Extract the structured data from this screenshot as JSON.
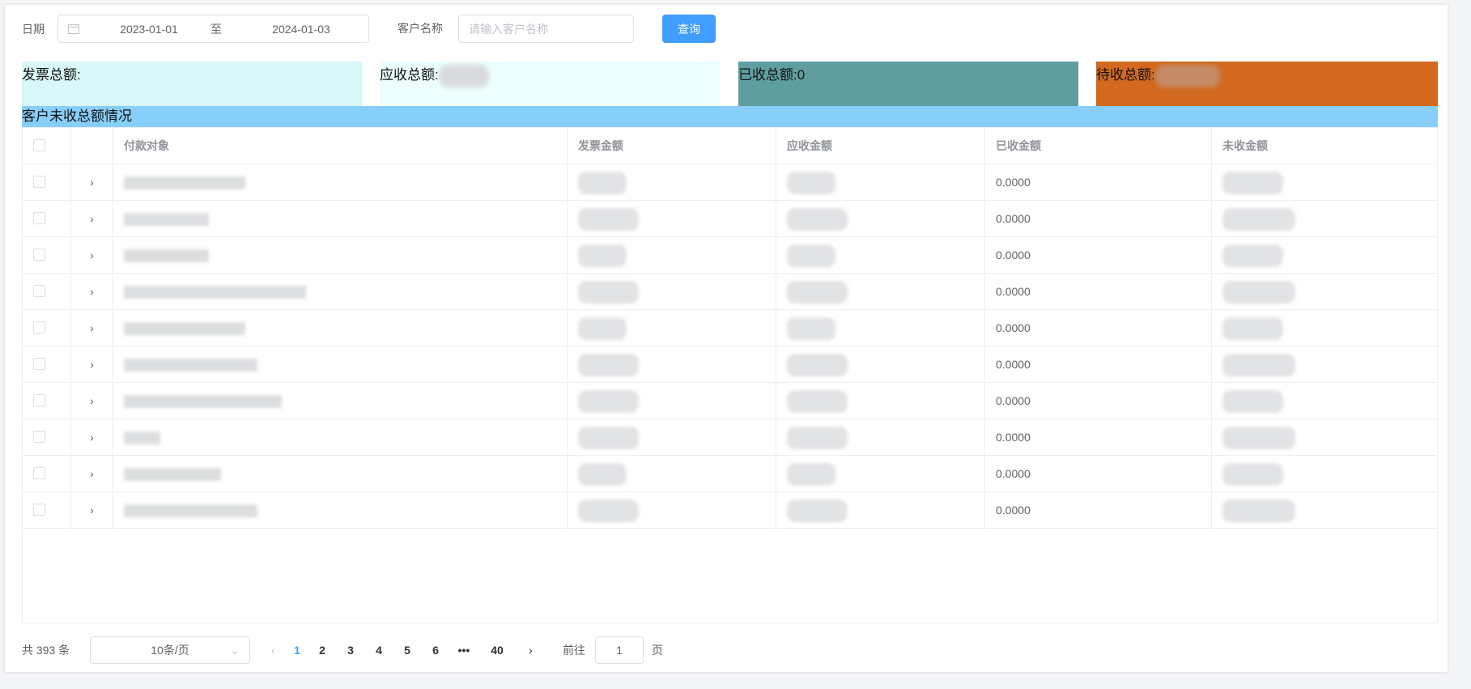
{
  "filter": {
    "date_label": "日期",
    "date_start": "2023-01-01",
    "date_separator": "至",
    "date_end": "2024-01-03",
    "customer_label": "客户名称",
    "customer_placeholder": "请输入客户名称",
    "query_button": "查询"
  },
  "summary": {
    "invoice_total_label": "发票总额:",
    "receivable_total_label": "应收总额:",
    "received_total_label": "已收总额:0",
    "pending_total_label": "待收总额:",
    "colors": {
      "invoice": "#d9f6f8",
      "receivable": "#ecfefe",
      "received": "#5f9ea0",
      "pending": "#d2691e"
    }
  },
  "section_title": "客户未收总额情况",
  "table": {
    "columns": [
      "付款对象",
      "发票金额",
      "应收金额",
      "已收金额",
      "未收金额"
    ],
    "rows": [
      {
        "received": "0.0000"
      },
      {
        "received": "0.0000"
      },
      {
        "received": "0.0000"
      },
      {
        "received": "0.0000"
      },
      {
        "received": "0.0000"
      },
      {
        "received": "0.0000"
      },
      {
        "received": "0.0000"
      },
      {
        "received": "0.0000"
      },
      {
        "received": "0.0000"
      },
      {
        "received": "0.0000"
      }
    ]
  },
  "pagination": {
    "total_text": "共 393 条",
    "page_size": "10条/页",
    "pages": [
      "1",
      "2",
      "3",
      "4",
      "5",
      "6",
      "•••",
      "40"
    ],
    "current_page": "1",
    "goto_label": "前往",
    "goto_value": "1",
    "page_suffix": "页"
  },
  "icons": {
    "calendar": "calendar-icon",
    "expand": "chevron-right-icon",
    "prev": "chevron-left-icon",
    "next": "chevron-right-icon",
    "dropdown": "chevron-down-icon"
  },
  "accent_color": "#409eff",
  "section_color": "#87cefa"
}
